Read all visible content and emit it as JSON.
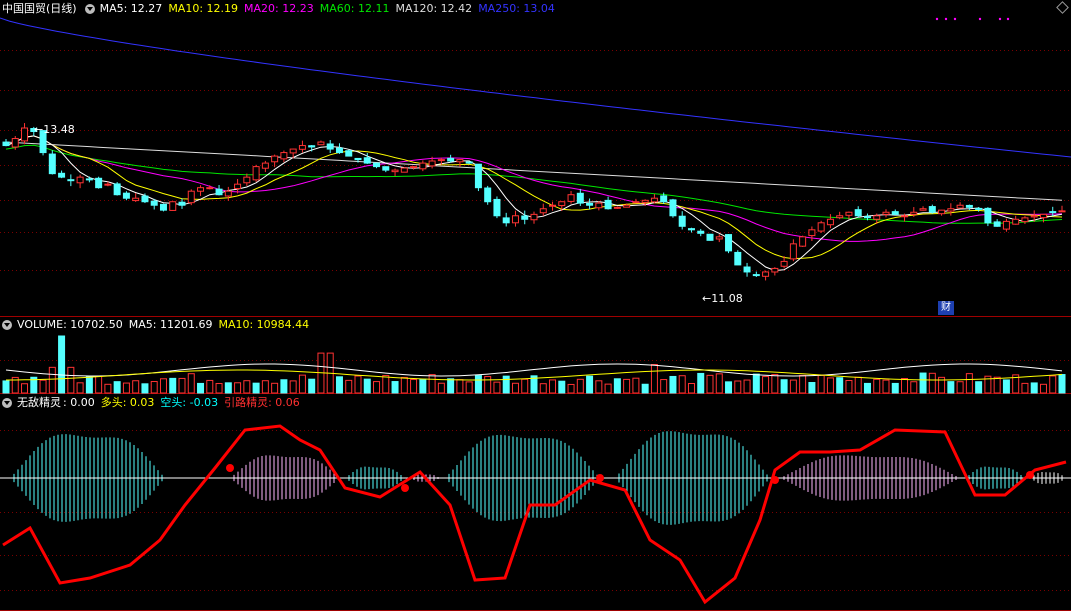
{
  "header_price": {
    "title": "中国国贸(日线)",
    "items": [
      {
        "label": "MA5: 12.27",
        "color": "#ffffff"
      },
      {
        "label": "MA10: 12.19",
        "color": "#ffff00"
      },
      {
        "label": "MA20: 12.23",
        "color": "#ff00ff"
      },
      {
        "label": "MA60: 12.11",
        "color": "#00e600"
      },
      {
        "label": "MA120: 12.42",
        "color": "#dddddd"
      },
      {
        "label": "MA250: 13.04",
        "color": "#3333ff"
      }
    ]
  },
  "header_volume": {
    "items": [
      {
        "label": "VOLUME: 10702.50",
        "color": "#ffffff"
      },
      {
        "label": "MA5: 11201.69",
        "color": "#ffffff"
      },
      {
        "label": "MA10: 10984.44",
        "color": "#ffff00"
      }
    ]
  },
  "header_indicator": {
    "title": "无敌精灵",
    "items": [
      {
        "label": ": 0.00",
        "color": "#ffffff"
      },
      {
        "label": "多头: 0.03",
        "color": "#ffff00"
      },
      {
        "label": "空头: -0.03",
        "color": "#00ffff"
      },
      {
        "label": "引路精灵: 0.06",
        "color": "#ff3030"
      }
    ]
  },
  "annotations": {
    "high": "13.48",
    "low": "11.08",
    "badge": "财"
  },
  "colors": {
    "up": "#ff3333",
    "down": "#54ffff",
    "grid": "#7a0000",
    "border": "#a00000",
    "signal": "#ff0000"
  },
  "chart_data": {
    "type": "candlestick",
    "title": "中国国贸(日线)",
    "price_extremes": {
      "high": 13.48,
      "low": 11.08
    },
    "ma_last": {
      "MA5": 12.27,
      "MA10": 12.19,
      "MA20": 12.23,
      "MA60": 12.11,
      "MA120": 12.42,
      "MA250": 13.04
    },
    "closes": [
      13.2,
      13.3,
      13.45,
      13.4,
      13.1,
      12.8,
      12.75,
      12.7,
      12.75,
      12.72,
      12.6,
      12.65,
      12.5,
      12.45,
      12.45,
      12.4,
      12.35,
      12.28,
      12.4,
      12.35,
      12.55,
      12.6,
      12.6,
      12.5,
      12.55,
      12.65,
      12.75,
      12.9,
      12.95,
      13.05,
      13.1,
      13.15,
      13.2,
      13.18,
      13.25,
      13.15,
      13.1,
      13.05,
      13.0,
      12.95,
      12.9,
      12.85,
      12.85,
      12.88,
      12.9,
      12.95,
      12.98,
      13.0,
      12.98,
      13.0,
      12.95,
      12.6,
      12.4,
      12.2,
      12.1,
      12.2,
      12.15,
      12.22,
      12.3,
      12.35,
      12.4,
      12.5,
      12.38,
      12.35,
      12.38,
      12.3,
      12.32,
      12.35,
      12.4,
      12.42,
      12.45,
      12.4,
      12.2,
      12.05,
      12.0,
      11.95,
      11.85,
      11.9,
      11.7,
      11.5,
      11.4,
      11.35,
      11.4,
      11.45,
      11.55,
      11.8,
      11.9,
      12.0,
      12.1,
      12.15,
      12.2,
      12.25,
      12.2,
      12.18,
      12.2,
      12.25,
      12.22,
      12.2,
      12.25,
      12.3,
      12.25,
      12.28,
      12.3,
      12.35,
      12.32,
      12.3,
      12.1,
      12.05,
      12.12,
      12.15,
      12.17,
      12.2,
      12.22,
      12.25,
      12.27
    ],
    "volume": {
      "last": 10702.5,
      "ma5": 11201.69,
      "ma10": 10984.44
    },
    "indicator": {
      "base": 0.0,
      "long": 0.03,
      "short": -0.03,
      "guide": 0.06
    }
  }
}
